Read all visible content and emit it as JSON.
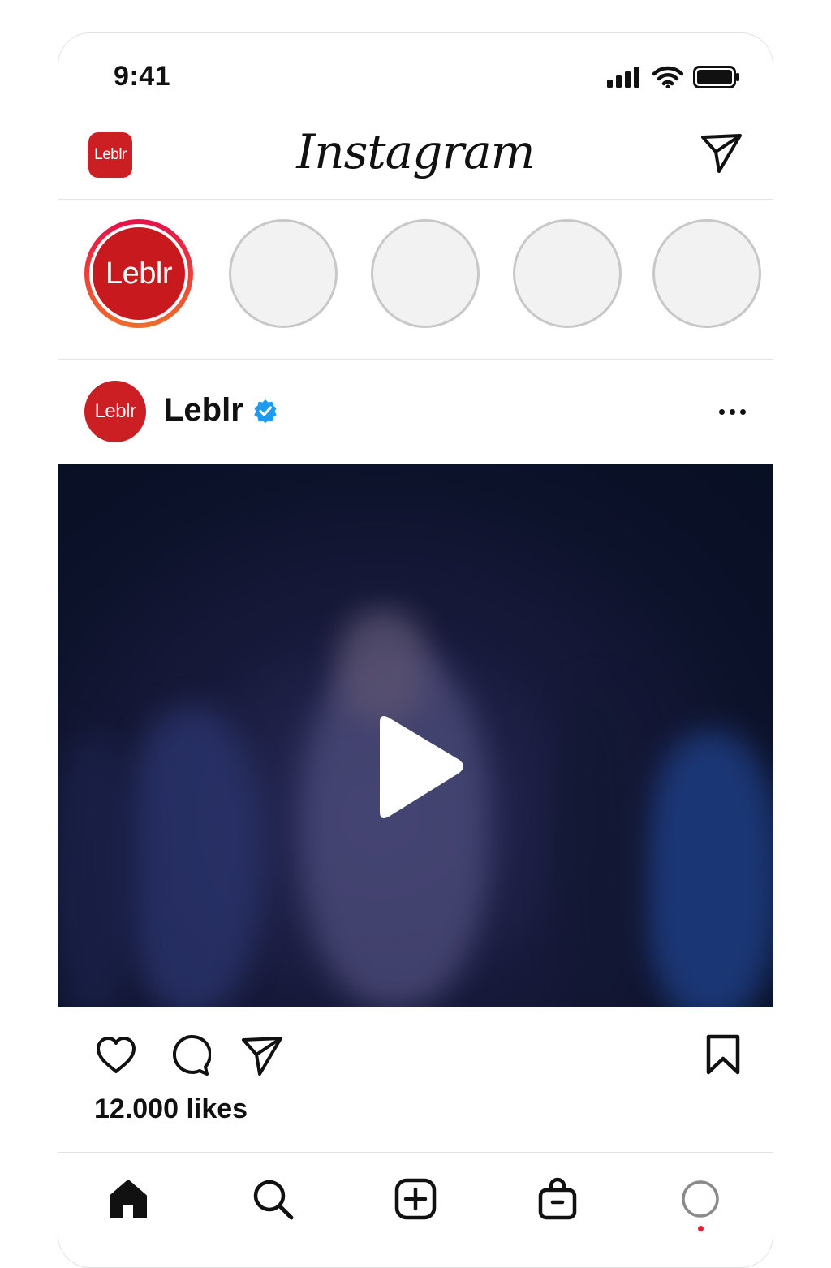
{
  "status_bar": {
    "time": "9:41",
    "icons": [
      "signal-icon",
      "wifi-icon",
      "battery-icon"
    ]
  },
  "header": {
    "brand_logo_text": "Leblr",
    "wordmark": "Instagram",
    "right_icon": "direct-message-icon"
  },
  "stories": {
    "own_label": "Leblr",
    "empty_count": 4
  },
  "post": {
    "username": "Leblr",
    "avatar_text": "Leblr",
    "verified": true,
    "media_type": "video",
    "likes_text": "12.000 likes"
  },
  "actions": {
    "left": [
      "heart-icon",
      "comment-icon",
      "share-icon"
    ],
    "right": [
      "bookmark-icon"
    ]
  },
  "bottom_nav": {
    "items": [
      "home-icon",
      "search-icon",
      "create-icon",
      "shop-icon",
      "profile-icon"
    ],
    "active": "home-icon"
  },
  "colors": {
    "brand_red": "#cc1f24",
    "story_ring_start": "#e8104a",
    "story_ring_end": "#f06d2a",
    "verified_blue": "#1d9bf0",
    "media_bg": "#0b1128",
    "notification_dot": "#e0242d"
  }
}
